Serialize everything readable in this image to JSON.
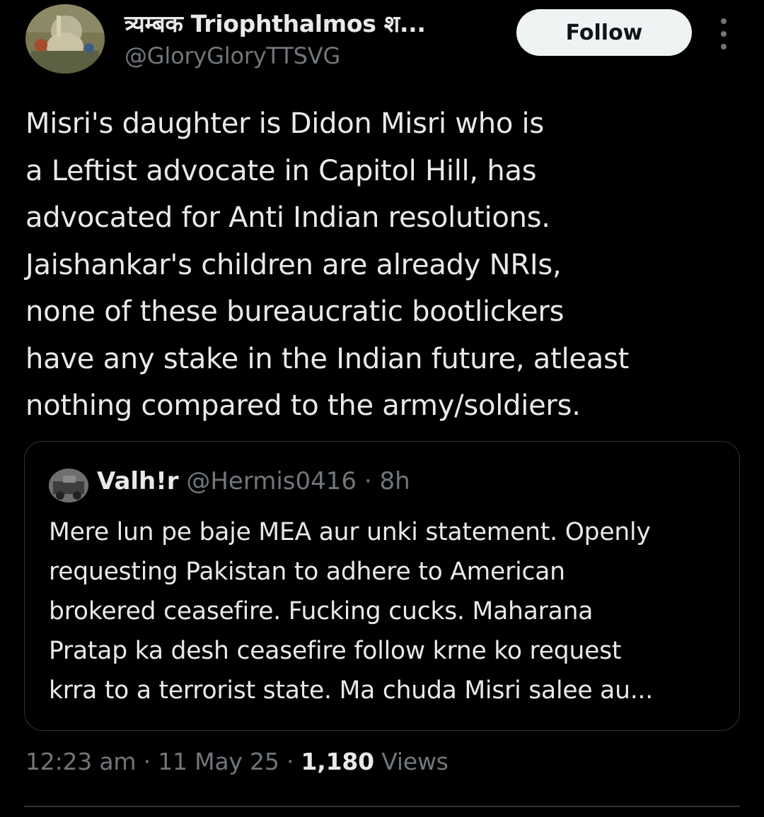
{
  "author": {
    "display_name": "त्र्यम्बक Triophthalmos श...",
    "handle": "@GloryGloryTTSVG",
    "avatar_icon": "avatar-painting"
  },
  "actions": {
    "follow_label": "Follow",
    "more_icon": "more-vertical-icon"
  },
  "tweet": {
    "lines": [
      "Misri's daughter is Didon Misri who is",
      "a Leftist advocate in Capitol Hill, has",
      "advocated for Anti Indian resolutions.",
      "Jaishankar's children are already NRIs,",
      "none of these bureaucratic bootlickers",
      "have any stake in the Indian future, atleast",
      "nothing compared to the army/soldiers."
    ]
  },
  "quote": {
    "name": "Valh!r",
    "handle": "@Hermis0416",
    "separator": "·",
    "time": "8h",
    "lines": [
      "Mere lun pe baje MEA aur unki statement. Openly",
      "requesting Pakistan to adhere to American",
      "brokered ceasefire. Fucking cucks. Maharana",
      "Pratap ka desh ceasefire follow krne ko request",
      "krra to a terrorist state. Ma chuda Misri salee au..."
    ]
  },
  "meta": {
    "time": "12:23 am",
    "separator": "·",
    "date": "11 May 25",
    "views_count": "1,180",
    "views_label": "Views"
  },
  "colors": {
    "background": "#000000",
    "primary_text": "#e7e9ea",
    "secondary_text": "#71767b",
    "border": "#2f3336",
    "follow_button_bg": "#eff3f4"
  }
}
